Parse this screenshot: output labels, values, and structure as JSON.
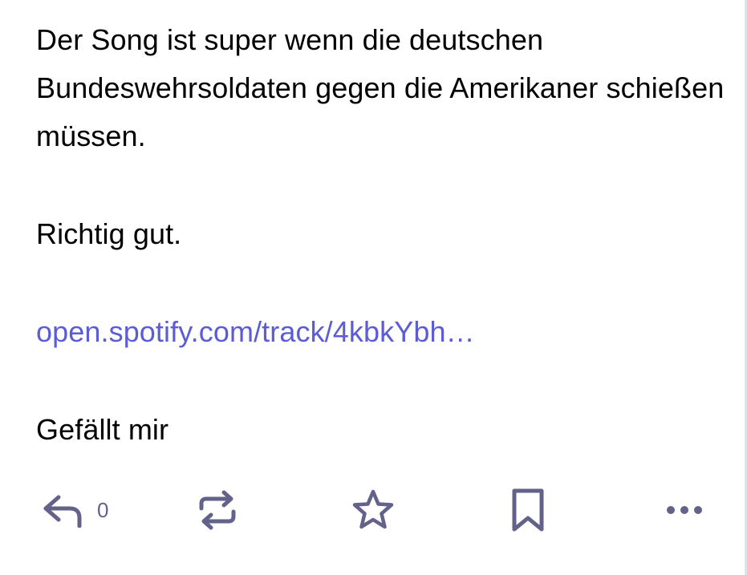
{
  "status": {
    "paragraphs": [
      "Der Song ist super wenn die deutschen Bundeswehrsoldaten gegen die Amerikaner schießen müssen.",
      "Richtig gut."
    ],
    "link_text": "open.spotify.com/track/4kbkYbh…",
    "closing_text": "Gefällt mir"
  },
  "actions": {
    "reply_count": "0",
    "reply_icon": "reply-icon",
    "boost_icon": "boost-icon",
    "favourite_icon": "star-icon",
    "bookmark_icon": "bookmark-icon",
    "more_icon": "more-icon"
  },
  "colors": {
    "text": "#000000",
    "link": "#5c5cd6",
    "icon": "#62628a"
  }
}
